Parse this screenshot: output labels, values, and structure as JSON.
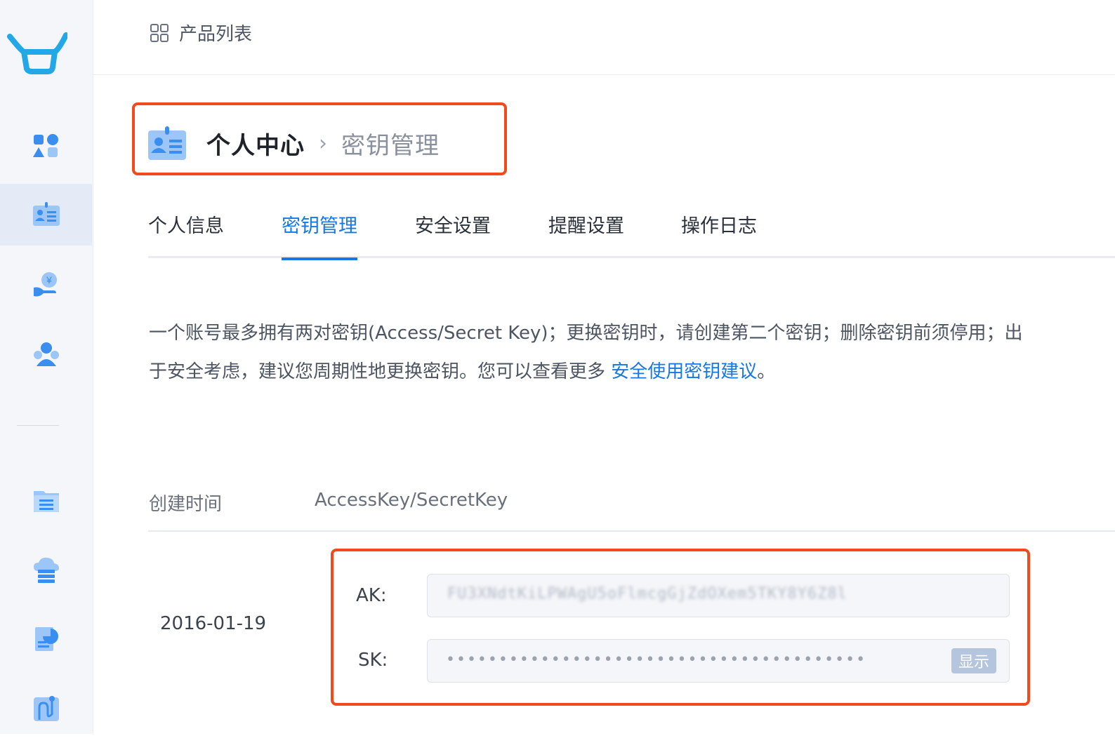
{
  "topbar": {
    "product_list_label": "产品列表"
  },
  "breadcrumb": {
    "root": "个人中心",
    "separator": "›",
    "current": "密钥管理"
  },
  "tabs": [
    {
      "label": "个人信息"
    },
    {
      "label": "密钥管理",
      "active": true
    },
    {
      "label": "安全设置"
    },
    {
      "label": "提醒设置"
    },
    {
      "label": "操作日志"
    }
  ],
  "description": {
    "text": "一个账号最多拥有两对密钥(Access/Secret Key)；更换密钥时，请创建第二个密钥；删除密钥前须停用；出于安全考虑，建议您周期性地更换密钥。您可以查看更多 ",
    "link": "安全使用密钥建议",
    "suffix": "。"
  },
  "table": {
    "headers": [
      "创建时间",
      "AccessKey/SecretKey"
    ],
    "rows": [
      {
        "created": "2016-01-19",
        "ak_label": "AK:",
        "ak_value": "FU3XNdtKiLPWAgU5oFlmcgGjZdOXem5TKY8Y6Z8l",
        "sk_label": "SK:",
        "sk_value": "••••••••••••••••••••••••••••••••••••••••",
        "show_label": "显示"
      }
    ]
  },
  "colors": {
    "accent": "#1677e6",
    "highlight": "#f24a1c",
    "sidebar_bg": "#f4f6f9"
  },
  "sidebar_icons": [
    "logo-icon",
    "products-icon",
    "personal-center-icon",
    "billing-icon",
    "user-group-icon",
    "documents-icon",
    "cloud-storage-icon",
    "report-icon",
    "workflow-icon"
  ]
}
